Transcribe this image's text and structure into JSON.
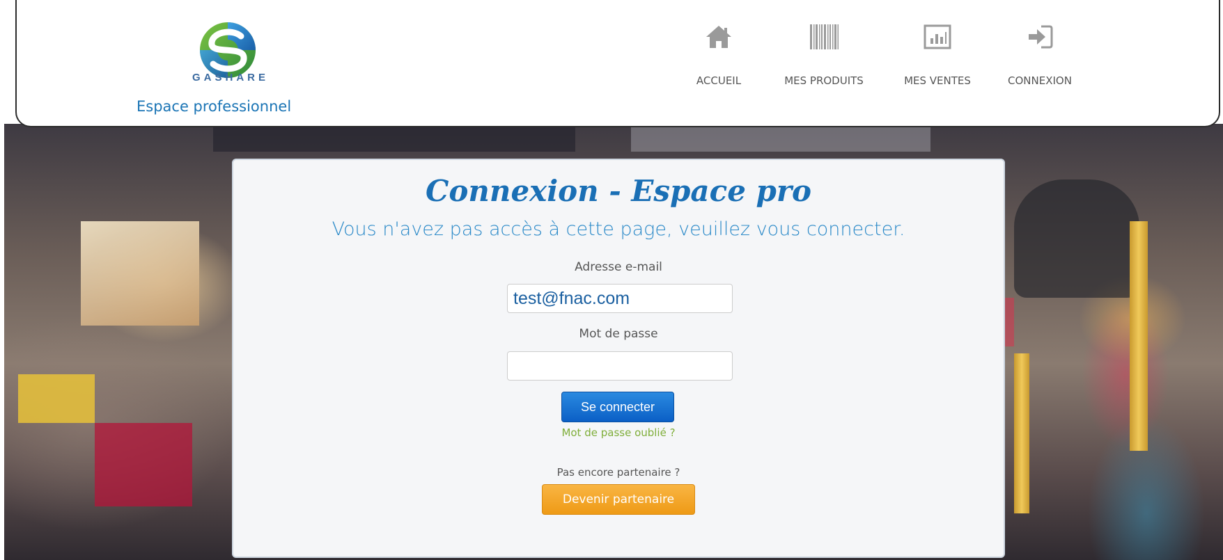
{
  "header": {
    "brand_name": "GASHARE",
    "subtitle": "Espace professionnel",
    "nav": [
      {
        "label": "ACCUEIL",
        "icon": "home-icon"
      },
      {
        "label": "MES PRODUITS",
        "icon": "barcode-icon"
      },
      {
        "label": "MES VENTES",
        "icon": "bar-chart-icon"
      },
      {
        "label": "CONNEXION",
        "icon": "sign-in-icon"
      }
    ]
  },
  "login": {
    "title": "Connexion - Espace pro",
    "message": "Vous n'avez pas accès à cette page, veuillez vous connecter.",
    "email_label": "Adresse e-mail",
    "email_value": "test@fnac.com",
    "password_label": "Mot de passe",
    "password_value": "",
    "submit_label": "Se connecter",
    "forgot_label": "Mot de passe oublié ?",
    "partner_question": "Pas encore partenaire ?",
    "partner_button": "Devenir partenaire"
  },
  "colors": {
    "accent_blue": "#1a6fb5",
    "login_button": "#0b5fc6",
    "partner_button": "#ee9a16",
    "forgot_link": "#7fae3a"
  }
}
